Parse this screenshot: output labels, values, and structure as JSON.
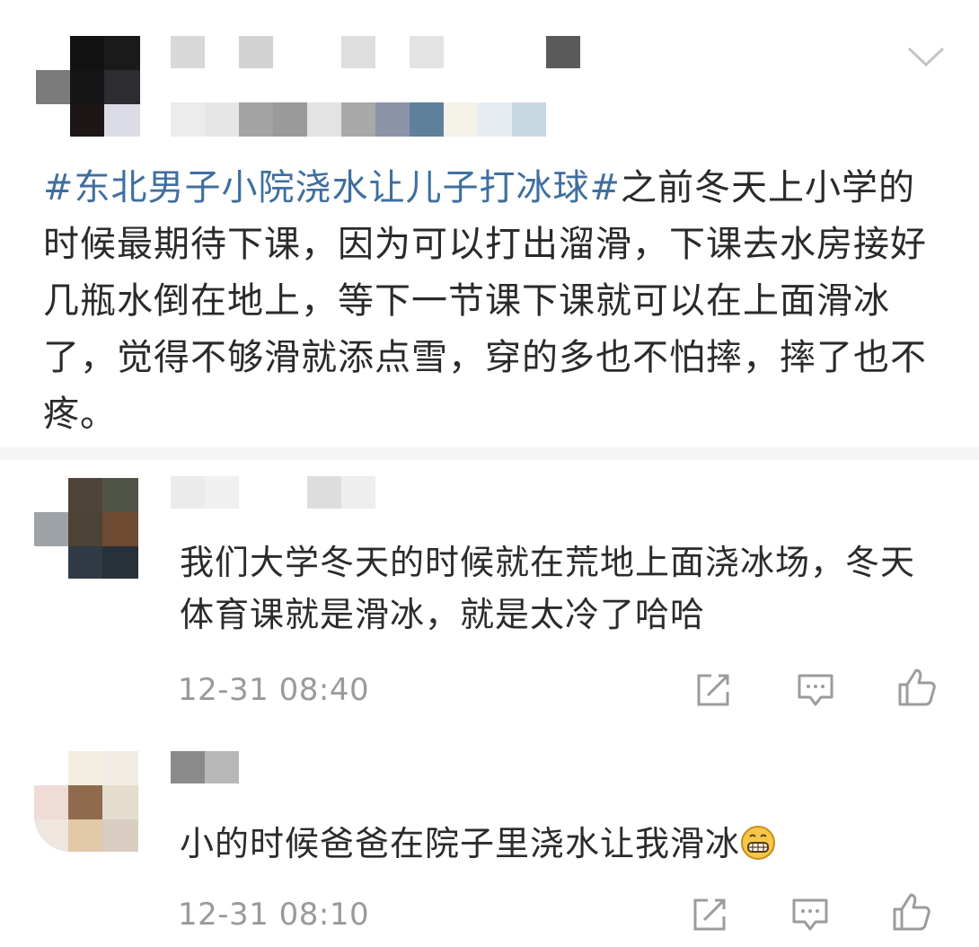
{
  "post": {
    "hashtag": "#东北男子小院浇水让儿子打冰球#",
    "text": "之前冬天上小学的时候最期待下课，因为可以打出溜滑，下课去水房接好几瓶水倒在地上，等下一节课下课就可以在上面滑冰了，觉得不够滑就添点雪，穿的多也不怕摔，摔了也不疼。",
    "menu_icon": "chevron-down-icon"
  },
  "comments": [
    {
      "text": "我们大学冬天的时候就在荒地上面浇冰场，冬天体育课就是滑冰，就是太冷了哈哈",
      "time": "12-31 08:40"
    },
    {
      "text": "小的时候爸爸在院子里浇水让我滑冰",
      "emoji": "grin-emoji",
      "time": "12-31 08:10"
    }
  ],
  "actions": [
    "share-icon",
    "reply-icon",
    "like-icon"
  ],
  "colors": {
    "hashtag": "#3f6fa0",
    "timestamp": "#9a9a9a",
    "text": "#2b2b2b"
  }
}
